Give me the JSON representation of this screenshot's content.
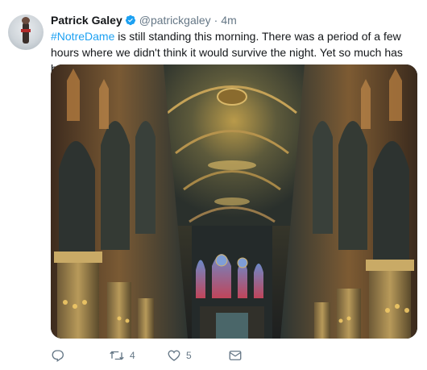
{
  "tweet": {
    "name": "Patrick Galey",
    "handle": "@patrickgaley",
    "separator": "·",
    "time": "4m",
    "hashtag": "#NotreDame",
    "text": " is still standing this morning. There was a period of a few hours where we didn't think it would survive the night. Yet so much has been lost"
  },
  "actions": {
    "reply_icon": "reply-icon",
    "retweet_icon": "retweet-icon",
    "retweet_count": "4",
    "like_icon": "heart-icon",
    "like_count": "5",
    "message_icon": "envelope-icon"
  },
  "colors": {
    "link": "#1da1f2",
    "muted": "#657786",
    "text": "#14171a"
  }
}
